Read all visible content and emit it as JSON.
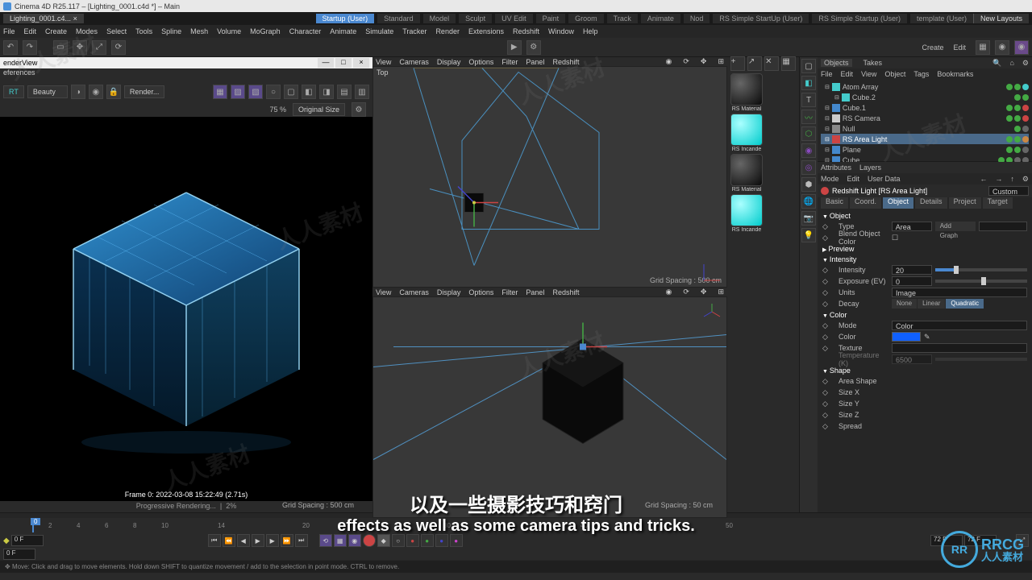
{
  "titlebar": {
    "text": "Cinema 4D R25.117 – [Lighting_0001.c4d *] – Main"
  },
  "file_tab": "Lighting_0001.c4...",
  "layout_tabs": [
    "Startup (User)",
    "Standard",
    "Model",
    "Sculpt",
    "UV Edit",
    "Paint",
    "Groom",
    "Track",
    "Animate",
    "Nod",
    "RS Simple StartUp (User)",
    "RS Simple Startup (User)",
    "template (User)"
  ],
  "new_layout": "New Layouts",
  "menubar": [
    "File",
    "Edit",
    "Create",
    "Modes",
    "Select",
    "Tools",
    "Spline",
    "Mesh",
    "Volume",
    "MoGraph",
    "Character",
    "Animate",
    "Simulate",
    "Tracker",
    "Render",
    "Extensions",
    "Redshift",
    "Window",
    "Help"
  ],
  "render": {
    "title": "enderView",
    "prefs": "eferences",
    "rt": "RT",
    "beauty": "Beauty",
    "render_label": "Render...",
    "zoom": "75 %",
    "original": "Original Size",
    "frame_info": "Frame  0: 2022-03-08 15:22:49 (2.71s)",
    "progressive": "Progressive Rendering...",
    "progressive_pct": "2%"
  },
  "viewport_menu": [
    "View",
    "Cameras",
    "Display",
    "Options",
    "Filter",
    "Panel",
    "Redshift"
  ],
  "vp_top_label": "Top",
  "grid_spacing_500": "Grid Spacing : 500 cm",
  "grid_spacing_50": "Grid Spacing : 50 cm",
  "materials": [
    {
      "name": "RS Material",
      "kind": "black"
    },
    {
      "name": "RS Incande",
      "kind": "cyan"
    },
    {
      "name": "RS Material",
      "kind": "black"
    },
    {
      "name": "RS Incande",
      "kind": "cyan"
    }
  ],
  "obj_tabs": [
    "Objects",
    "Takes"
  ],
  "obj_menu": [
    "File",
    "Edit",
    "View",
    "Object",
    "Tags",
    "Bookmarks"
  ],
  "obj_tree": [
    {
      "indent": 0,
      "icon": "#4cc",
      "name": "Atom Array",
      "dots": [
        "green",
        "green",
        "cyan"
      ]
    },
    {
      "indent": 1,
      "icon": "#4cc",
      "name": "Cube.2",
      "dots": [
        "green",
        "green"
      ]
    },
    {
      "indent": 0,
      "icon": "#48c",
      "name": "Cube.1",
      "dots": [
        "green",
        "green",
        "red"
      ]
    },
    {
      "indent": 0,
      "icon": "#ccc",
      "name": "RS Camera",
      "dots": [
        "green",
        "green",
        "red"
      ]
    },
    {
      "indent": 0,
      "icon": "#888",
      "name": "Null",
      "dots": [
        "green",
        "grey"
      ]
    },
    {
      "indent": 0,
      "icon": "#c44",
      "name": "RS Area Light",
      "selected": true,
      "dots": [
        "green",
        "green",
        "orange"
      ]
    },
    {
      "indent": 0,
      "icon": "#48c",
      "name": "Plane",
      "dots": [
        "green",
        "green",
        "grey"
      ]
    },
    {
      "indent": 0,
      "icon": "#48c",
      "name": "Cube",
      "dots": [
        "green",
        "green",
        "grey",
        "grey"
      ]
    }
  ],
  "attr_tabs_top": [
    "Attributes",
    "Layers"
  ],
  "attr_menu": [
    "Mode",
    "Edit",
    "User Data"
  ],
  "attr_title": "Redshift Light [RS Area Light]",
  "attr_custom": "Custom",
  "attr_tabs": [
    "Basic",
    "Coord.",
    "Object",
    "Details",
    "Project",
    "Target"
  ],
  "attr": {
    "object_label": "Object",
    "type_label": "Type",
    "type_value": "Area",
    "add_graph": "Add Graph",
    "blend_label": "Blend Object Color",
    "preview_label": "Preview",
    "intensity_section": "Intensity",
    "intensity_label": "Intensity",
    "intensity_value": "20",
    "exposure_label": "Exposure (EV)",
    "exposure_value": "0",
    "units_label": "Units",
    "units_value": "Image",
    "decay_label": "Decay",
    "decay_none": "None",
    "decay_linear": "Linear",
    "decay_quadratic": "Quadratic",
    "color_section": "Color",
    "mode_label": "Mode",
    "mode_value": "Color",
    "color_label": "Color",
    "texture_label": "Texture",
    "temperature_value": "6500",
    "shape_section": "Shape",
    "area_shape_label": "Area Shape",
    "sizex_label": "Size X",
    "sizey_label": "Size Y",
    "sizez_label": "Size Z",
    "spread_label": "Spread"
  },
  "playback": {
    "start": "0 F",
    "end": "0 F",
    "range_end": "72 F",
    "range_end2": "72 F"
  },
  "statusbar": "Move: Click and drag to move elements. Hold down SHIFT to quantize movement / add to the selection in point mode. CTRL to remove.",
  "subtitle": {
    "cn": "以及一些摄影技巧和窍门",
    "en": "effects as well as some camera tips and tricks."
  },
  "watermark_text": "人人素材",
  "watermark_corner": {
    "logo": "RR",
    "cn": "RRCG",
    "sub": "人人素材"
  }
}
